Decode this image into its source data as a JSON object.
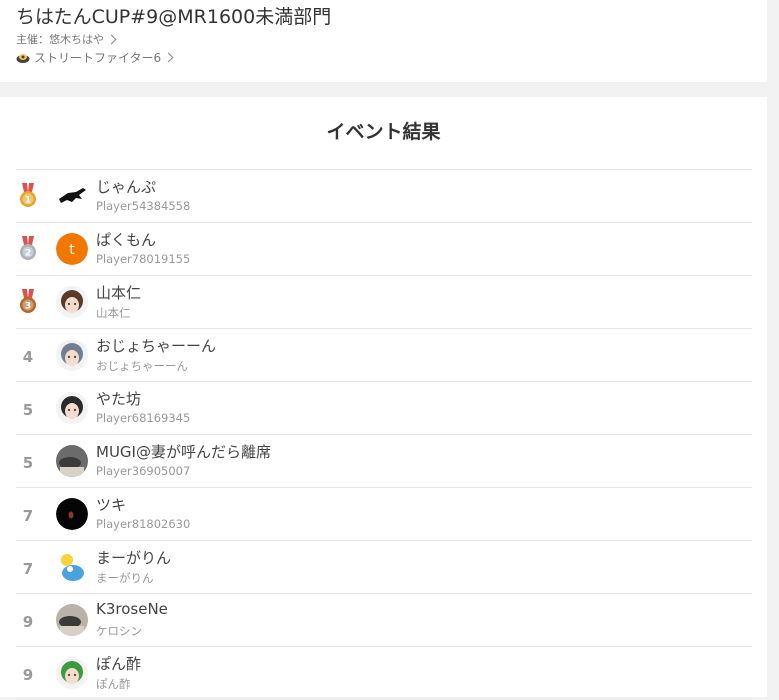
{
  "event": {
    "title": "ちはたんCUP#9@MR1600未満部門",
    "organizer": "主催：悠木ちはや",
    "game": "ストリートファイター6"
  },
  "results": {
    "heading": "イベント結果",
    "rows": [
      {
        "rank": "1",
        "medal": "gold",
        "name": "じゃんぷ",
        "sub": "Player54384558",
        "avatar": "silhouette-avatar"
      },
      {
        "rank": "2",
        "medal": "silver",
        "name": "ぱくもん",
        "sub": "Player78019155",
        "avatar": "letter-avatar",
        "avatar_letter": "t",
        "avatar_color": "#f07800"
      },
      {
        "rank": "3",
        "medal": "bronze",
        "name": "山本仁",
        "sub": "山本仁",
        "avatar": "anime-girl-avatar"
      },
      {
        "rank": "4",
        "medal": "",
        "name": "おじょちゃーーん",
        "sub": "おじょちゃーーん",
        "avatar": "anime-character-avatar"
      },
      {
        "rank": "5",
        "medal": "",
        "name": "やた坊",
        "sub": "Player68169345",
        "avatar": "anime-character-avatar"
      },
      {
        "rank": "5",
        "medal": "",
        "name": "MUGI@妻が呼んだら離席",
        "sub": "Player36905007",
        "avatar": "photo-avatar"
      },
      {
        "rank": "7",
        "medal": "",
        "name": "ツキ",
        "sub": "Player81802630",
        "avatar": "moon-avatar"
      },
      {
        "rank": "7",
        "medal": "",
        "name": "まーがりん",
        "sub": "まーがりん",
        "avatar": "illustration-avatar"
      },
      {
        "rank": "9",
        "medal": "",
        "name": "K3roseNe",
        "sub": "ケロシン",
        "avatar": "photo-avatar"
      },
      {
        "rank": "9",
        "medal": "",
        "name": "ぽん酢",
        "sub": "ぽん酢",
        "avatar": "anime-character-avatar"
      }
    ]
  },
  "colors": {
    "gold": "#e8a628",
    "silver": "#a9b2bb",
    "bronze": "#b5672a",
    "ribbon": "#d9534f"
  }
}
